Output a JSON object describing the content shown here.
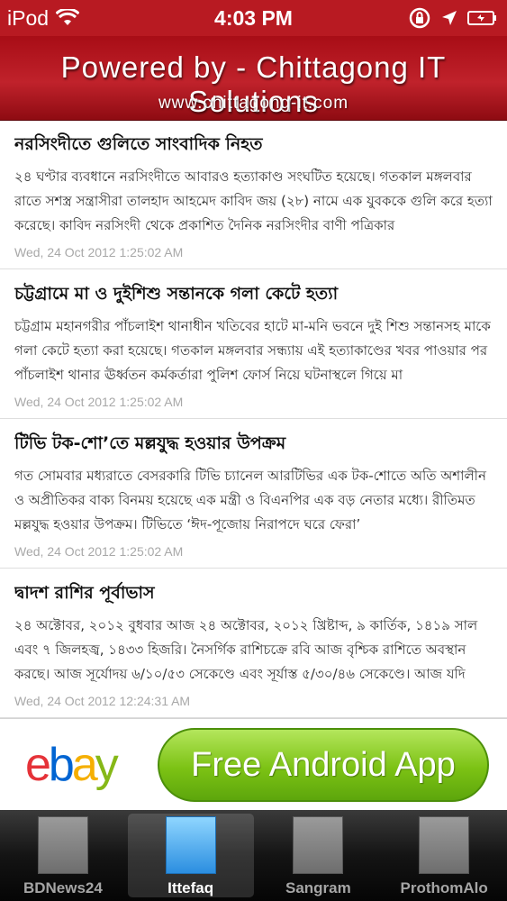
{
  "status_bar": {
    "carrier": "iPod",
    "time": "4:03 PM"
  },
  "header": {
    "title": "Powered by - Chittagong IT Solutions",
    "url": "www.chittagong-it.com"
  },
  "news": [
    {
      "title": "নরসিংদীতে গুলিতে সাংবাদিক নিহত",
      "summary": "২৪ ঘণ্টার ব্যবধানে নরসিংদীতে আবারও হত্যাকাণ্ড সংঘটিত হয়েছে। গতকাল মঙ্গলবার রাতে সশস্ত্র সন্ত্রাসীরা তালহাদ আহমেদ কাবিদ জয় (২৮) নামে এক যুবককে গুলি করে হত্যা করেছে। কাবিদ নরসিংদী থেকে প্রকাশিত দৈনিক নরসিংদীর বাণী পত্রিকার",
      "date": "Wed, 24 Oct 2012 1:25:02 AM"
    },
    {
      "title": "চট্টগ্রামে মা ও দুইশিশু সন্তানকে গলা কেটে হত্যা",
      "summary": "চট্টগ্রাম মহানগরীর পাঁচলাইশ থানাধীন খতিবের হাটে মা-মনি ভবনে দুই শিশু সন্তানসহ মাকে গলা কেটে হত্যা করা হয়েছে। গতকাল মঙ্গলবার সন্ধ্যায় এই হত্যাকাণ্ডের খবর পাওয়ার পর পাঁচলাইশ থানার ঊর্ধ্বতন কর্মকর্তারা পুলিশ ফোর্স নিয়ে ঘটনাস্থলে গিয়ে মা",
      "date": "Wed, 24 Oct 2012 1:25:02 AM"
    },
    {
      "title": "টিভি টক-শো’তে মল্লযুদ্ধ হওয়ার উপক্রম",
      "summary": "গত সোমবার মধ্যরাতে বেসরকারি টিভি চ্যানেল আরটিভির এক টক-শোতে অতি অশালীন ও অপ্রীতিকর বাক্য বিনময় হয়েছে এক মন্ত্রী ও বিএনপির এক বড় নেতার মধ্যে। রীতিমত মল্লযুদ্ধ হওয়ার উপক্রম। টিভিতে ‘ঈদ-পূজোয় নিরাপদে ঘরে ফেরা’",
      "date": "Wed, 24 Oct 2012 1:25:02 AM"
    },
    {
      "title": "দ্বাদশ রাশির পূর্বাভাস",
      "summary": "২৪ অক্টোবর, ২০১২ বুধবার  আজ ২৪ অক্টোবর, ২০১২ খ্রিষ্টাব্দ, ৯ কার্তিক, ১৪১৯ সাল এবং ৭ জিলহজ্ব, ১৪৩৩ হিজরি। নৈসর্গিক রাশিচক্রে রবি আজ বৃশ্চিক রাশিতে অবস্থান করছে। আজ সূর্যোদয় ৬/১০/৫৩ সেকেণ্ডে এবং সূর্যাস্ত ৫/৩০/৪৬ সেকেণ্ডে। আজ যদি",
      "date": "Wed, 24 Oct 2012 12:24:31 AM"
    }
  ],
  "ad": {
    "brand_letters": [
      "e",
      "b",
      "a",
      "y"
    ],
    "button_label": "Free Android App"
  },
  "tabs": [
    {
      "label": "BDNews24",
      "active": false
    },
    {
      "label": "Ittefaq",
      "active": true
    },
    {
      "label": "Sangram",
      "active": false
    },
    {
      "label": "ProthomAlo",
      "active": false
    }
  ],
  "colors": {
    "header_red": "#b81a22",
    "active_tab_icon": "#2b8ee0",
    "ad_button_green": "#7cc214"
  }
}
